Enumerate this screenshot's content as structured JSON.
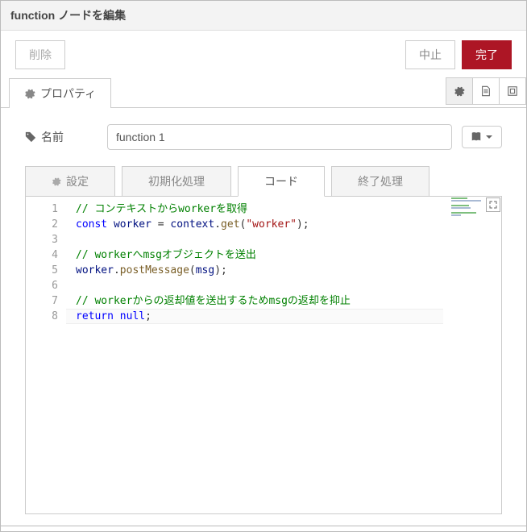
{
  "header": {
    "title": "function ノードを編集"
  },
  "buttons": {
    "delete": "削除",
    "cancel": "中止",
    "done": "完了"
  },
  "main_tab": {
    "label": "プロパティ"
  },
  "name": {
    "label": "名前",
    "value": "function 1"
  },
  "code_tabs": {
    "setup": "設定",
    "init": "初期化処理",
    "code": "コード",
    "close": "終了処理",
    "active_index": 2
  },
  "code_lines": [
    {
      "n": 1,
      "tokens": [
        {
          "t": "comment",
          "v": "// コンテキストからworkerを取得"
        }
      ]
    },
    {
      "n": 2,
      "tokens": [
        {
          "t": "keyword",
          "v": "const"
        },
        {
          "t": "plain",
          "v": " "
        },
        {
          "t": "ident",
          "v": "worker"
        },
        {
          "t": "plain",
          "v": " "
        },
        {
          "t": "punc",
          "v": "="
        },
        {
          "t": "plain",
          "v": " "
        },
        {
          "t": "ident",
          "v": "context"
        },
        {
          "t": "punc",
          "v": "."
        },
        {
          "t": "method",
          "v": "get"
        },
        {
          "t": "punc",
          "v": "("
        },
        {
          "t": "string",
          "v": "\"worker\""
        },
        {
          "t": "punc",
          "v": ");"
        }
      ]
    },
    {
      "n": 3,
      "tokens": []
    },
    {
      "n": 4,
      "tokens": [
        {
          "t": "comment",
          "v": "// workerへmsgオブジェクトを送出"
        }
      ]
    },
    {
      "n": 5,
      "tokens": [
        {
          "t": "ident",
          "v": "worker"
        },
        {
          "t": "punc",
          "v": "."
        },
        {
          "t": "method",
          "v": "postMessage"
        },
        {
          "t": "punc",
          "v": "("
        },
        {
          "t": "ident",
          "v": "msg"
        },
        {
          "t": "punc",
          "v": ");"
        }
      ]
    },
    {
      "n": 6,
      "tokens": []
    },
    {
      "n": 7,
      "tokens": [
        {
          "t": "comment",
          "v": "// workerからの返却値を送出するためmsgの返却を抑止"
        }
      ]
    },
    {
      "n": 8,
      "tokens": [
        {
          "t": "keyword",
          "v": "return"
        },
        {
          "t": "plain",
          "v": " "
        },
        {
          "t": "keyword",
          "v": "null"
        },
        {
          "t": "punc",
          "v": ";"
        }
      ]
    }
  ],
  "current_line": 8
}
